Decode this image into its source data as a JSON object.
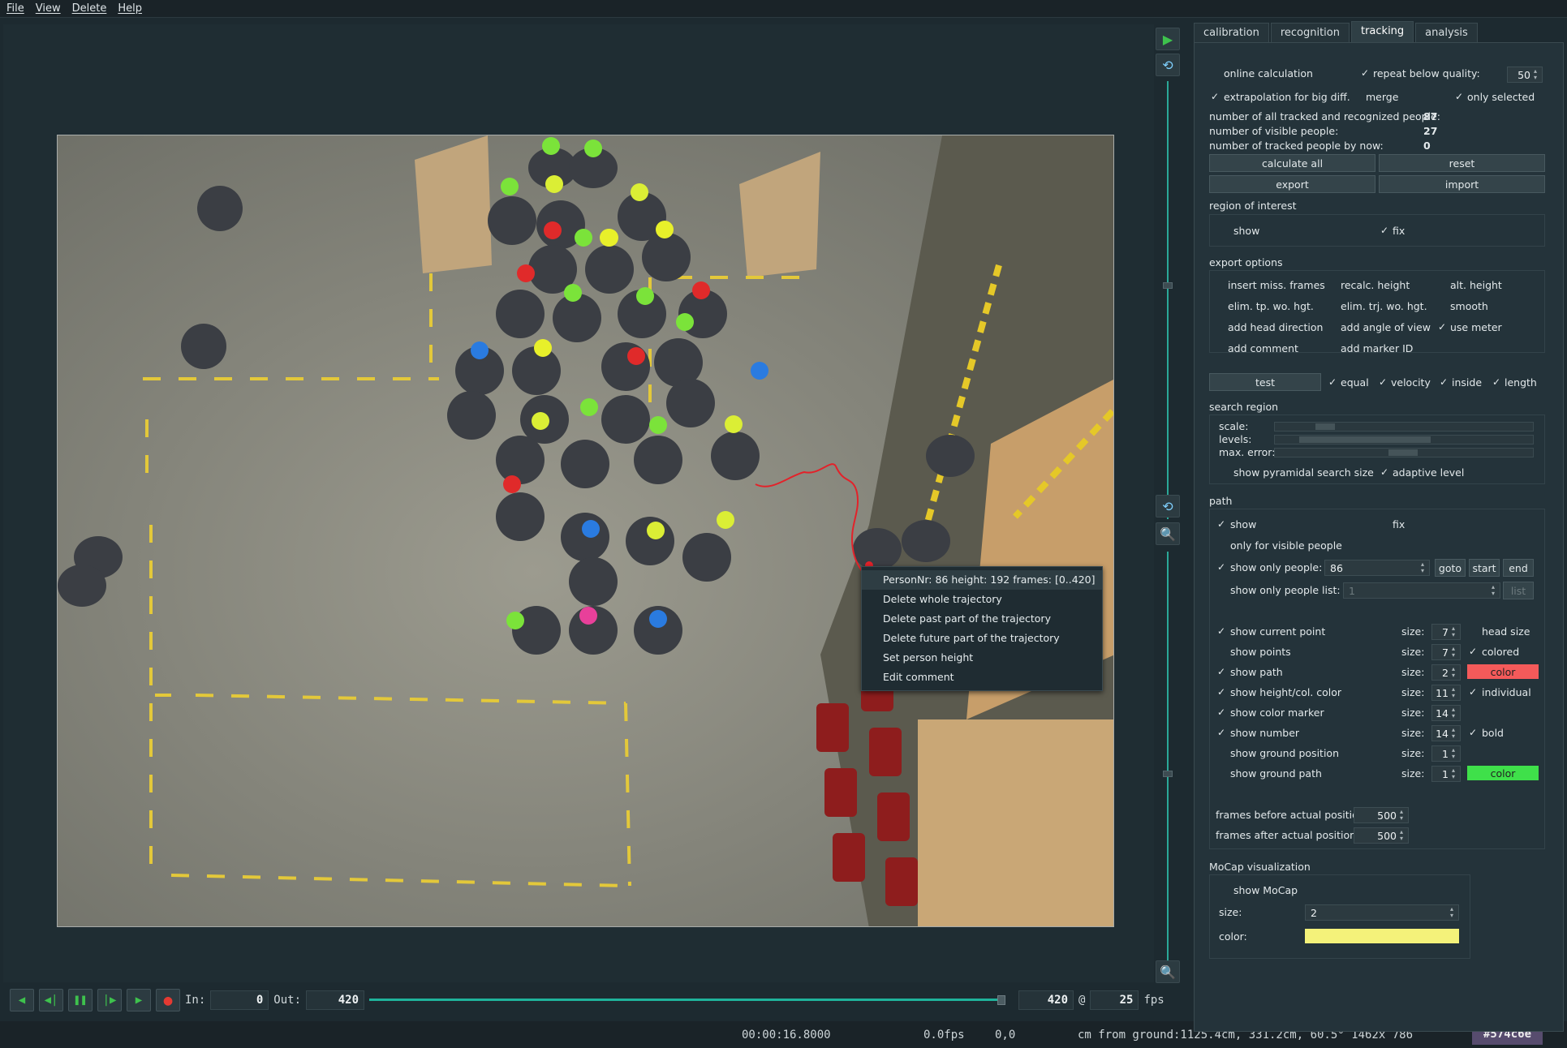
{
  "menu": [
    "File",
    "View",
    "Delete",
    "Help"
  ],
  "context_menu": {
    "header": "PersonNr: 86 height: 192 frames: [0..420]",
    "items": [
      "Delete whole trajectory",
      "Delete past part of the trajectory",
      "Delete future part of the trajectory",
      "Set person height",
      "Edit comment"
    ]
  },
  "player": {
    "in_label": "In:",
    "in_value": "0",
    "out_label": "Out:",
    "out_value": "420",
    "frame": "420",
    "at": "@",
    "fps_value": "25",
    "fps_label": "fps",
    "slider_fraction": 1.0
  },
  "status": {
    "time": "00:00:16.8000",
    "fps": "0.0fps",
    "coord": "0,0",
    "ground": "cm from ground:1125.4cm, 331.2cm, 60.5° 1462x 786",
    "color_hex": "#574c6e"
  },
  "tabs": [
    "calibration",
    "recognition",
    "tracking",
    "analysis"
  ],
  "active_tab": "tracking",
  "tracking": {
    "online_calculation": "online calculation",
    "repeat_below_quality": "repeat below quality:",
    "repeat_value": "50",
    "extrapolation": "extrapolation for big diff.",
    "merge": "merge",
    "only_selected": "only selected",
    "stat1_label": "number of all tracked and recognized people:",
    "stat1_value": "87",
    "stat2_label": "number of visible people:",
    "stat2_value": "27",
    "stat3_label": "number of tracked people by now:",
    "stat3_value": "0",
    "btn_calculate_all": "calculate all",
    "btn_reset": "reset",
    "btn_export": "export",
    "btn_import": "import",
    "roi_title": "region of interest",
    "roi_show": "show",
    "roi_fix": "fix",
    "export_title": "export options",
    "export_opts": [
      "insert miss. frames",
      "recalc. height",
      "alt. height",
      "elim. tp. wo. hgt.",
      "elim. trj. wo. hgt.",
      "smooth",
      "add head direction",
      "add angle of view",
      "use meter",
      "add comment",
      "add marker ID"
    ],
    "test": "test",
    "equal": "equal",
    "velocity": "velocity",
    "inside": "inside",
    "length": "length",
    "search_title": "search region",
    "scale": "scale:",
    "levels": "levels:",
    "max_error": "max. error:",
    "show_pyramidal": "show pyramidal search size",
    "adaptive_level": "adaptive level",
    "path_title": "path",
    "path_show": "show",
    "path_fix": "fix",
    "only_visible": "only for visible people",
    "show_only_people": "show only people:",
    "only_people_value": "86",
    "goto": "goto",
    "start": "start",
    "end": "end",
    "show_only_list": "show only people list:",
    "list_value": "1",
    "list_btn": "list",
    "size_label": "size:",
    "rows": [
      {
        "label": "show current point",
        "size": "7",
        "extra": "head size"
      },
      {
        "label": "show points",
        "size": "7",
        "extra": "colored"
      },
      {
        "label": "show path",
        "size": "2",
        "extra": "color"
      },
      {
        "label": "show height/col. color",
        "size": "11",
        "extra": "individual"
      },
      {
        "label": "show color marker",
        "size": "14",
        "extra": ""
      },
      {
        "label": "show number",
        "size": "14",
        "extra": "bold"
      },
      {
        "label": "show ground position",
        "size": "1",
        "extra": ""
      },
      {
        "label": "show ground path",
        "size": "1",
        "extra": "color"
      }
    ],
    "frames_before": "frames before actual position:",
    "frames_before_value": "500",
    "frames_after": "frames after actual position:",
    "frames_after_value": "500",
    "mocap_title": "MoCap visualization",
    "show_mocap": "show MoCap",
    "mocap_size": "size:",
    "mocap_size_value": "2",
    "mocap_color": "color:",
    "path_color": "#f45a5a",
    "ground_path_color": "#3fe04a",
    "mocap_color_value": "#f4f27a"
  }
}
